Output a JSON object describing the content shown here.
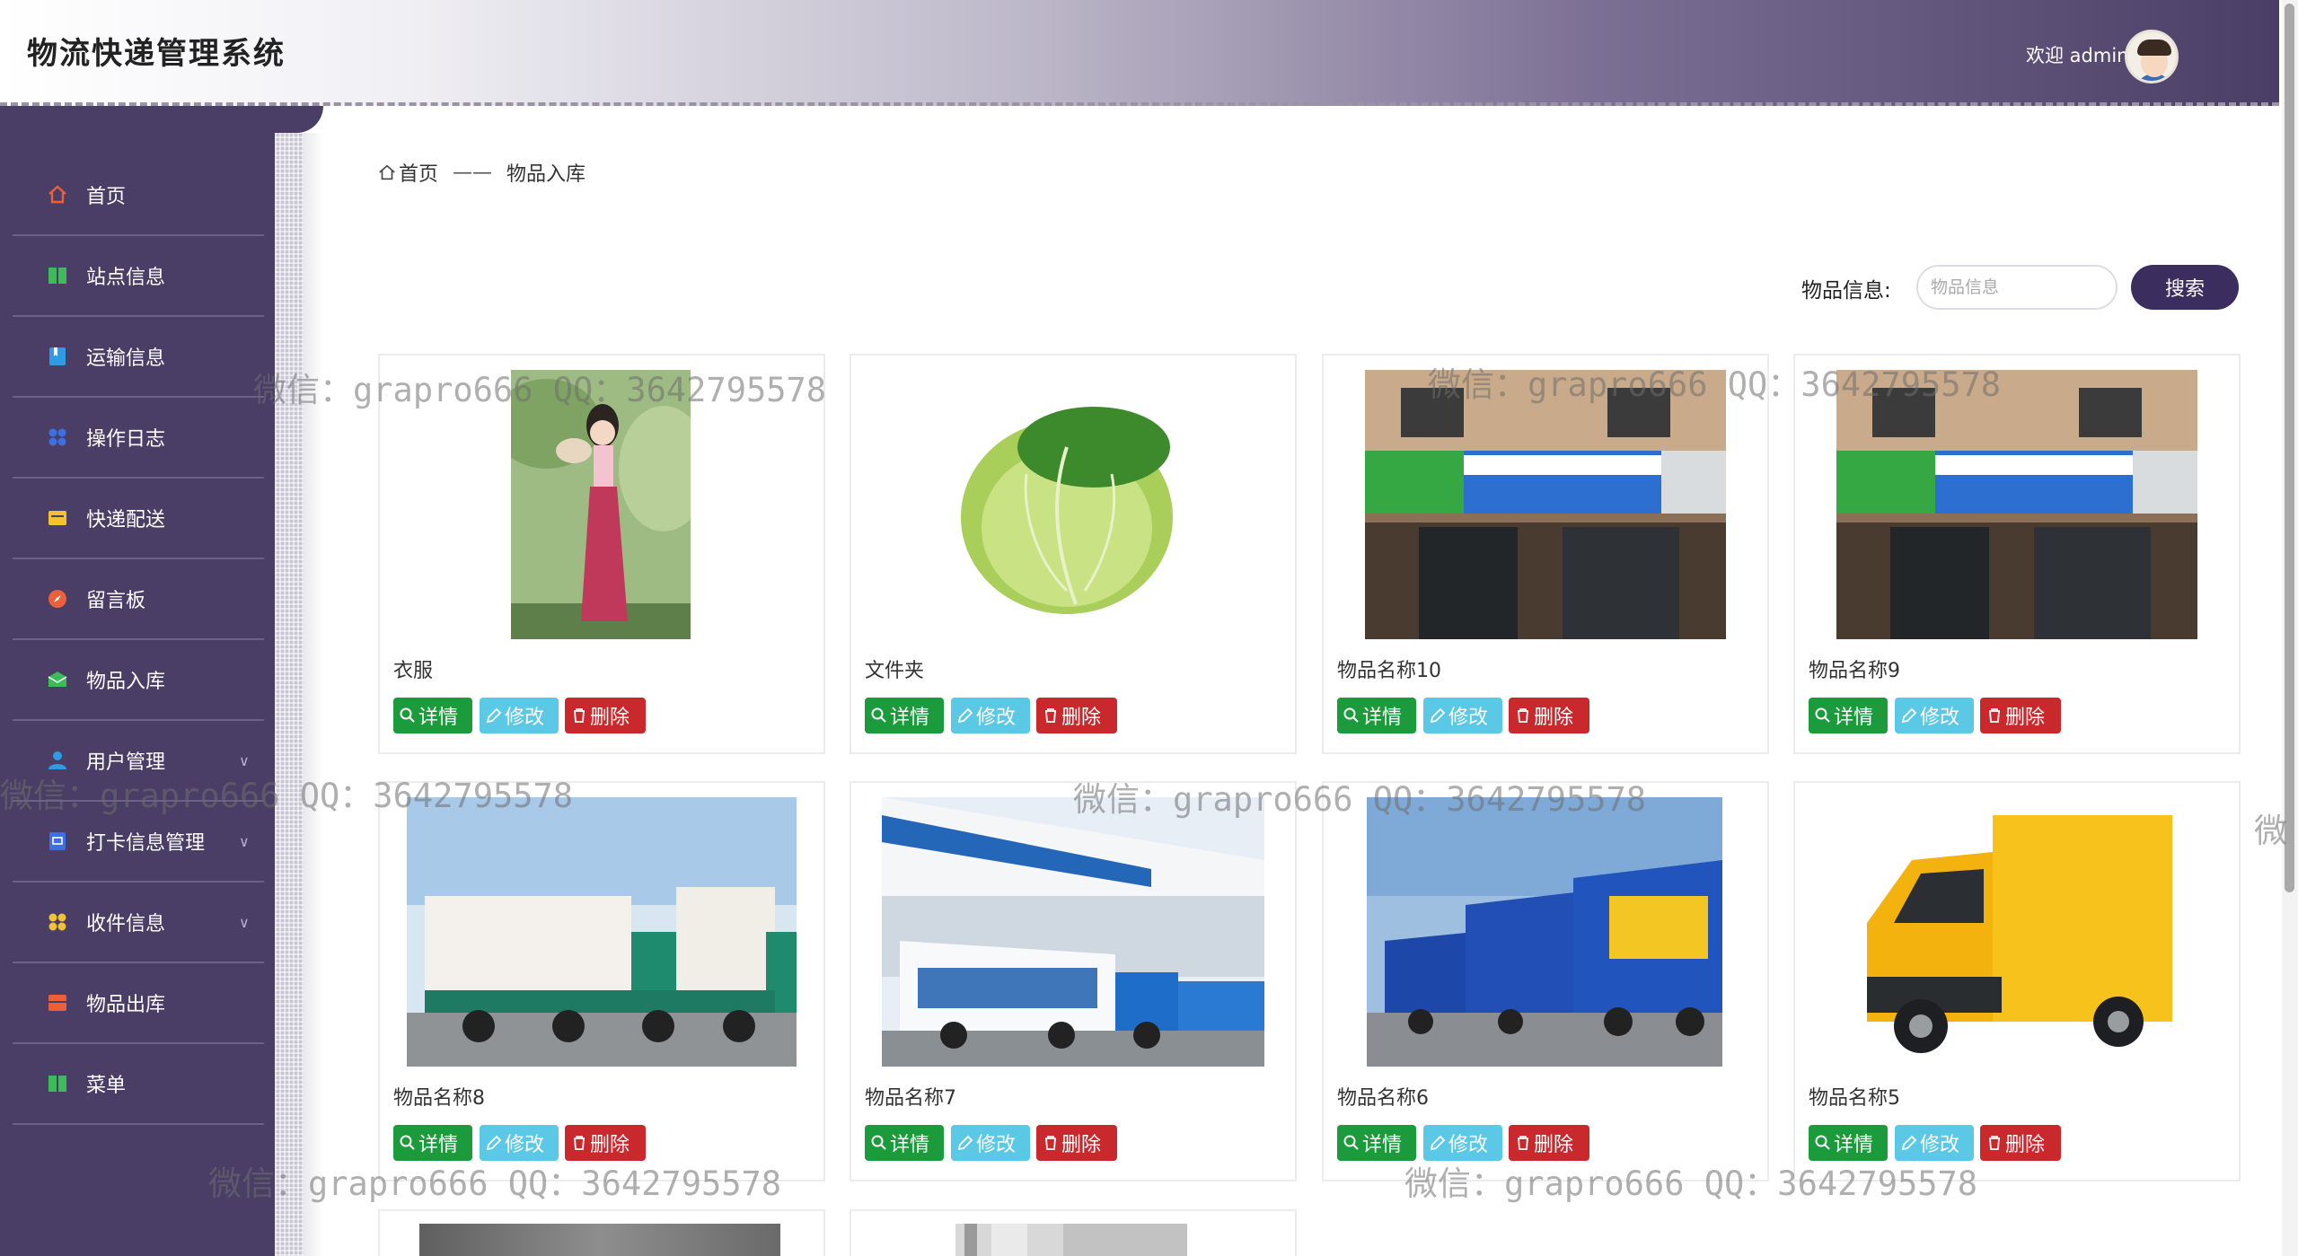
{
  "app_title": "物流快递管理系统",
  "header": {
    "welcome": "欢迎 admin"
  },
  "sidebar": {
    "items": [
      {
        "label": "首页",
        "icon": "home-icon",
        "color": "#e9603b",
        "expandable": false
      },
      {
        "label": "站点信息",
        "icon": "book-icon",
        "color": "#3dbb5a",
        "expandable": false
      },
      {
        "label": "运输信息",
        "icon": "bookmark-icon",
        "color": "#2e9be3",
        "expandable": false
      },
      {
        "label": "操作日志",
        "icon": "grid-icon",
        "color": "#3d6fe0",
        "expandable": false
      },
      {
        "label": "快递配送",
        "icon": "card-icon",
        "color": "#f1c232",
        "expandable": false
      },
      {
        "label": "留言板",
        "icon": "compass-icon",
        "color": "#e9603b",
        "expandable": false
      },
      {
        "label": "物品入库",
        "icon": "mail-icon",
        "color": "#3dbb5a",
        "expandable": false
      },
      {
        "label": "用户管理",
        "icon": "user-icon",
        "color": "#2e9be3",
        "expandable": true
      },
      {
        "label": "打卡信息管理",
        "icon": "clipboard-icon",
        "color": "#3d6fe0",
        "expandable": true
      },
      {
        "label": "收件信息",
        "icon": "apps-icon",
        "color": "#f1c232",
        "expandable": true
      },
      {
        "label": "物品出库",
        "icon": "box-icon",
        "color": "#e9603b",
        "expandable": false
      },
      {
        "label": "菜单",
        "icon": "book-icon",
        "color": "#3dbb5a",
        "expandable": false
      }
    ]
  },
  "breadcrumb": {
    "home": "首页",
    "separator": "——",
    "current": "物品入库"
  },
  "search": {
    "label": "物品信息:",
    "placeholder": "物品信息",
    "button": "搜索"
  },
  "buttons": {
    "detail": "详情",
    "edit": "修改",
    "delete": "删除"
  },
  "items": [
    {
      "name": "衣服",
      "image": "woman-in-hanfu-photo"
    },
    {
      "name": "文件夹",
      "image": "cabbage-photo"
    },
    {
      "name": "物品名称10",
      "image": "cainiao-station-photo"
    },
    {
      "name": "物品名称9",
      "image": "cainiao-station-photo"
    },
    {
      "name": "物品名称8",
      "image": "green-trucks-photo"
    },
    {
      "name": "物品名称7",
      "image": "zto-trucks-photo"
    },
    {
      "name": "物品名称6",
      "image": "blue-trucks-photo"
    },
    {
      "name": "物品名称5",
      "image": "yellow-van-photo"
    },
    {
      "name": "",
      "image": "gray-photo"
    },
    {
      "name": "",
      "image": "warehouse-photo"
    }
  ],
  "watermark": "微信：grapro666 QQ：3642795578",
  "watermark_partial": "微"
}
